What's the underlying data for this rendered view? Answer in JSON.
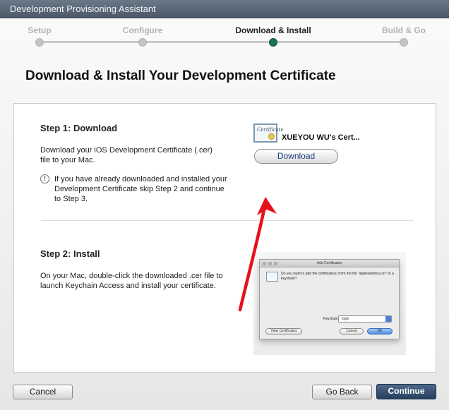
{
  "window": {
    "title": "Development Provisioning Assistant"
  },
  "steps": [
    {
      "label": "Setup",
      "state": "done"
    },
    {
      "label": "Configure",
      "state": "done"
    },
    {
      "label": "Download & Install",
      "state": "active"
    },
    {
      "label": "Build & Go",
      "state": "pending"
    }
  ],
  "page": {
    "heading": "Download & Install Your Development Certificate"
  },
  "step1": {
    "title": "Step 1: Download",
    "description": "Download your iOS Development Certificate (.cer) file to your Mac.",
    "note": "If you have already downloaded and installed your Development Certificate skip Step 2 and continue to Step 3.",
    "certificate_name": "XUEYOU WU's Cert...",
    "certificate_icon_text": "Certificate",
    "download_label": "Download"
  },
  "step2": {
    "title": "Step 2: Install",
    "description": "On your Mac, double-click the downloaded .cer file to launch Keychain Access and install your certificate."
  },
  "dialog_image": {
    "title": "Add Certificates",
    "message": "Do you want to add the certificate(s) from the file \"applewwdrca.cer\" to a keychain?",
    "keychain_label": "Keychain:",
    "keychain_value": "login",
    "view_label": "View Certificates",
    "cancel_label": "Cancel",
    "ok_label": "OK"
  },
  "footer": {
    "cancel_label": "Cancel",
    "back_label": "Go Back",
    "continue_label": "Continue"
  },
  "colors": {
    "titlebar": "#5a6878",
    "active_step": "#197252",
    "primary_button": "#26405f",
    "annotation_arrow": "#e8101c"
  }
}
